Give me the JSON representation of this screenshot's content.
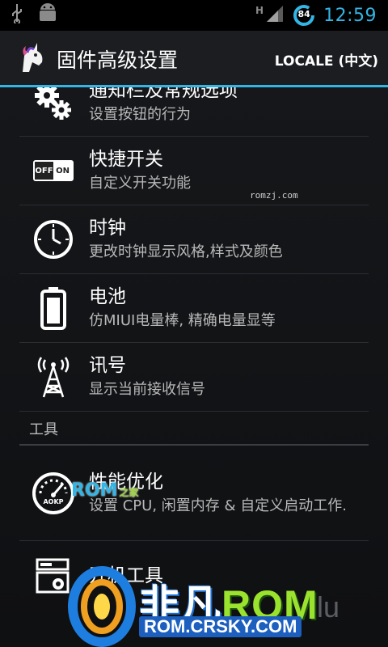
{
  "status_bar": {
    "time": "12:59",
    "battery_level": "84",
    "signal": "H"
  },
  "action_bar": {
    "title": "固件高级设置",
    "locale_button": "LOCALE (中文)"
  },
  "items": [
    {
      "icon": "gears-icon",
      "title": "通知栏及常规选项",
      "subtitle": "设置按钮的行为"
    },
    {
      "icon": "toggle-switch-icon",
      "title": "快捷开关",
      "subtitle": "自定义开关功能"
    },
    {
      "icon": "clock-icon",
      "title": "时钟",
      "subtitle": "更改时钟显示风格,样式及颜色"
    },
    {
      "icon": "battery-icon",
      "title": "电池",
      "subtitle": "仿MIUI电量棒, 精确电量显等"
    },
    {
      "icon": "signal-tower-icon",
      "title": "讯号",
      "subtitle": "显示当前接收信号"
    }
  ],
  "section_tools": "工具",
  "tools": [
    {
      "icon": "speedometer-icon",
      "title": "性能优化",
      "subtitle": "设置 CPU, 闲置内存 & 自定义启动工作."
    },
    {
      "icon": "boot-tools-icon",
      "title": "开机工具",
      "subtitle": ""
    }
  ],
  "toggle_labels": {
    "off": "OFF",
    "on": "ON"
  },
  "gauge_label": "AOKP",
  "watermarks": {
    "small": "romzj.com",
    "rom": "ROM",
    "rom_zhi": "之家",
    "logo_han": "非凡",
    "logo_rom": "ROM",
    "logo_url": "ROM.CRSKY.COM",
    "logo_su": "lu"
  },
  "colors": {
    "accent": "#33b5e5",
    "background": "#121416"
  }
}
